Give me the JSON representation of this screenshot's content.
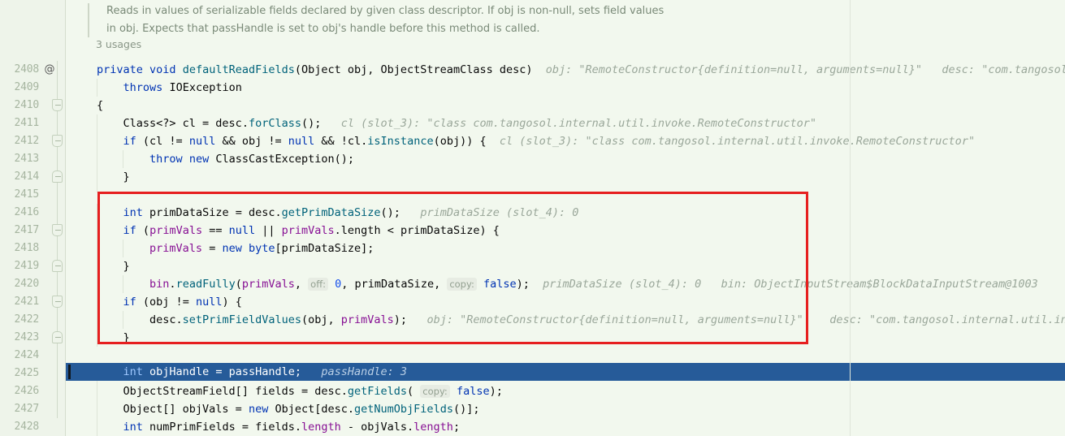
{
  "editor": {
    "language": "java",
    "theme": "IntelliJ Light",
    "colors": {
      "background": "#f2f8ee",
      "gutter_background": "#eef4ea",
      "keyword": "#0033b3",
      "method": "#00627a",
      "field": "#871094",
      "number": "#1750eb",
      "string": "#067d17",
      "inline_hint": "#9aa79a",
      "execution_highlight": "#265b99",
      "annotation_box": "#e61f1f",
      "line_number": "#a6b5a0"
    }
  },
  "doc_comment": {
    "line1": "Reads in values of serializable fields declared by given class descriptor. If obj is non-null, sets field values",
    "line2": "in obj. Expects that passHandle is set to obj's handle before this method is called."
  },
  "usages_label": "3 usages",
  "gutter": {
    "annotation_marker": "@",
    "fold_markers": [
      {
        "line": 2410,
        "type": "down"
      },
      {
        "line": 2412,
        "type": "down"
      },
      {
        "line": 2414,
        "type": "up"
      },
      {
        "line": 2417,
        "type": "down"
      },
      {
        "line": 2419,
        "type": "up"
      },
      {
        "line": 2421,
        "type": "down"
      },
      {
        "line": 2423,
        "type": "up"
      }
    ]
  },
  "lines": [
    {
      "num": "2408",
      "code": "private void defaultReadFields(Object obj, ObjectStreamClass desc)"
    },
    {
      "num": "2409",
      "code": "    throws IOException"
    },
    {
      "num": "2410",
      "code": "{"
    },
    {
      "num": "2411",
      "code": "    Class<?> cl = desc.forClass();"
    },
    {
      "num": "2412",
      "code": "    if (cl != null && obj != null && !cl.isInstance(obj)) {"
    },
    {
      "num": "2413",
      "code": "        throw new ClassCastException();"
    },
    {
      "num": "2414",
      "code": "    }"
    },
    {
      "num": "2415",
      "code": ""
    },
    {
      "num": "2416",
      "code": "    int primDataSize = desc.getPrimDataSize();"
    },
    {
      "num": "2417",
      "code": "    if (primVals == null || primVals.length < primDataSize) {"
    },
    {
      "num": "2418",
      "code": "        primVals = new byte[primDataSize];"
    },
    {
      "num": "2419",
      "code": "    }"
    },
    {
      "num": "2420",
      "code": "        bin.readFully(primVals, off: 0, primDataSize, copy: false);"
    },
    {
      "num": "2421",
      "code": "    if (obj != null) {"
    },
    {
      "num": "2422",
      "code": "        desc.setPrimFieldValues(obj, primVals);"
    },
    {
      "num": "2423",
      "code": "    }"
    },
    {
      "num": "2424",
      "code": ""
    },
    {
      "num": "2425",
      "code": "    int objHandle = passHandle;"
    },
    {
      "num": "2426",
      "code": "    ObjectStreamField[] fields = desc.getFields( copy: false);"
    },
    {
      "num": "2427",
      "code": "    Object[] objVals = new Object[desc.getNumObjFields()];"
    },
    {
      "num": "2428",
      "code": "    int numPrimFields = fields.length - objVals.length;"
    }
  ],
  "inline_hints": {
    "line2408_obj": "obj: \"RemoteConstructor{definition=null, arguments=null}\"",
    "line2408_desc": "desc: \"com.tangosol.",
    "line2411_cl": "cl (slot_3): \"class com.tangosol.internal.util.invoke.RemoteConstructor\"",
    "line2412_cl": "cl (slot_3): \"class com.tangosol.internal.util.invoke.RemoteConstructor\"",
    "line2416_primDataSize": "primDataSize (slot_4): 0",
    "line2420_primDataSize": "primDataSize (slot_4): 0",
    "line2420_bin": "bin: ObjectInputStream$BlockDataInputStream@1003",
    "line2422_obj": "obj: \"RemoteConstructor{definition=null, arguments=null}\"",
    "line2422_desc": "desc: \"com.tangosol.internal.util.invok",
    "line2425_passHandle": "passHandle: 3"
  },
  "parameter_hints": {
    "off": "off:",
    "copy": "copy:"
  },
  "execution_line": "2425",
  "annotation_box": {
    "label": "highlight-box",
    "covers_lines": "2416-2423"
  }
}
